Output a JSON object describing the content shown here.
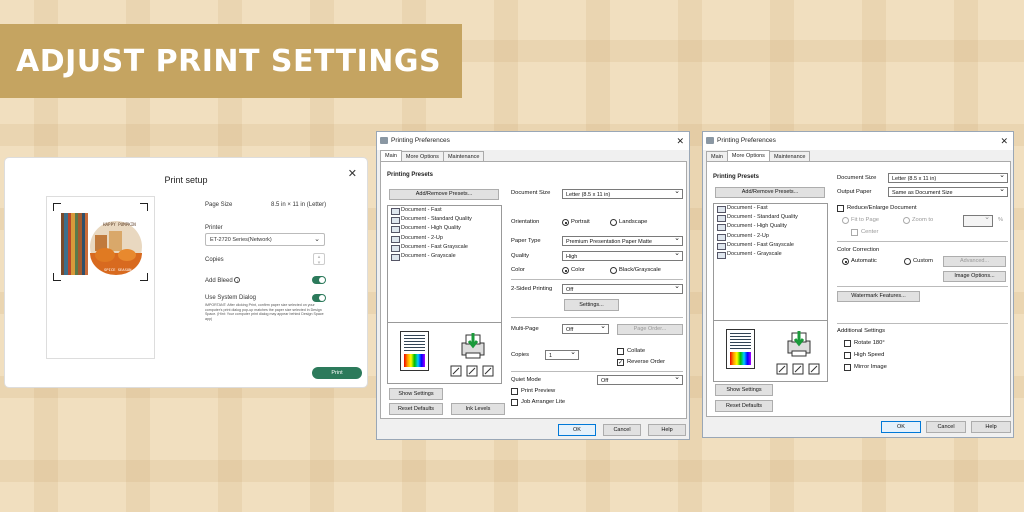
{
  "banner": {
    "title": "ADJUST PRINT SETTINGS"
  },
  "print_setup": {
    "title": "Print setup",
    "page_size_label": "Page Size",
    "page_size_value": "8.5 in × 11 in (Letter)",
    "printer_label": "Printer",
    "printer_value": "ET-2720 Series(Network)",
    "copies_label": "Copies",
    "add_bleed_label": "Add Bleed",
    "add_bleed_on": true,
    "system_dialog_label": "Use System Dialog",
    "system_dialog_on": true,
    "note": "IMPORTANT: After clicking Print, confirm paper size selected on your computer's print dialog pop-up matches the paper size selected in Design Space. (Hint: Your computer print dialog may appear behind Design Space app)",
    "print_button": "Print",
    "preview_art": {
      "line1": "HAPPY PUMPKIN",
      "line2": "SPICE SEASON"
    }
  },
  "pref1": {
    "title": "Printing Preferences",
    "tabs": [
      "Main",
      "More Options",
      "Maintenance"
    ],
    "active_tab": "Main",
    "presets_heading": "Printing Presets",
    "add_remove": "Add/Remove Presets...",
    "presets": [
      "Document - Fast",
      "Document - Standard Quality",
      "Document - High Quality",
      "Document - 2-Up",
      "Document - Fast Grayscale",
      "Document - Grayscale"
    ],
    "document_size_label": "Document Size",
    "document_size": "Letter (8.5 x 11 in)",
    "orientation_label": "Orientation",
    "portrait": "Portrait",
    "landscape": "Landscape",
    "paper_type_label": "Paper Type",
    "paper_type": "Premium Presentation Paper Matte",
    "quality_label": "Quality",
    "quality": "High",
    "color_label": "Color",
    "color": "Color",
    "bw": "Black/Grayscale",
    "two_sided_label": "2-Sided Printing",
    "two_sided": "Off",
    "settings_btn": "Settings...",
    "multipage_label": "Multi-Page",
    "multipage": "Off",
    "page_order": "Page Order...",
    "copies_label": "Copies",
    "copies": "1",
    "collate": "Collate",
    "reverse_order": "Reverse Order",
    "quiet_label": "Quiet Mode",
    "quiet": "Off",
    "print_preview": "Print Preview",
    "job_arranger": "Job Arranger Lite",
    "show_settings": "Show Settings",
    "reset_defaults": "Reset Defaults",
    "ink_levels": "Ink Levels",
    "ok": "OK",
    "cancel": "Cancel",
    "help": "Help"
  },
  "pref2": {
    "title": "Printing Preferences",
    "tabs": [
      "Main",
      "More Options",
      "Maintenance"
    ],
    "active_tab": "More Options",
    "presets_heading": "Printing Presets",
    "add_remove": "Add/Remove Presets...",
    "presets": [
      "Document - Fast",
      "Document - Standard Quality",
      "Document - High Quality",
      "Document - 2-Up",
      "Document - Fast Grayscale",
      "Document - Grayscale"
    ],
    "document_size_label": "Document Size",
    "document_size": "Letter (8.5 x 11 in)",
    "output_paper_label": "Output Paper",
    "output_paper": "Same as Document Size",
    "reduce_enlarge": "Reduce/Enlarge Document",
    "fit_to_page": "Fit to Page",
    "zoom_to": "Zoom to",
    "center": "Center",
    "percent": "%",
    "color_correction_label": "Color Correction",
    "automatic": "Automatic",
    "custom": "Custom",
    "advanced": "Advanced...",
    "image_options": "Image Options...",
    "watermark": "Watermark Features...",
    "additional_label": "Additional Settings",
    "rotate": "Rotate 180°",
    "high_speed": "High Speed",
    "mirror": "Mirror Image",
    "show_settings": "Show Settings",
    "reset_defaults": "Reset Defaults",
    "ok": "OK",
    "cancel": "Cancel",
    "help": "Help"
  }
}
